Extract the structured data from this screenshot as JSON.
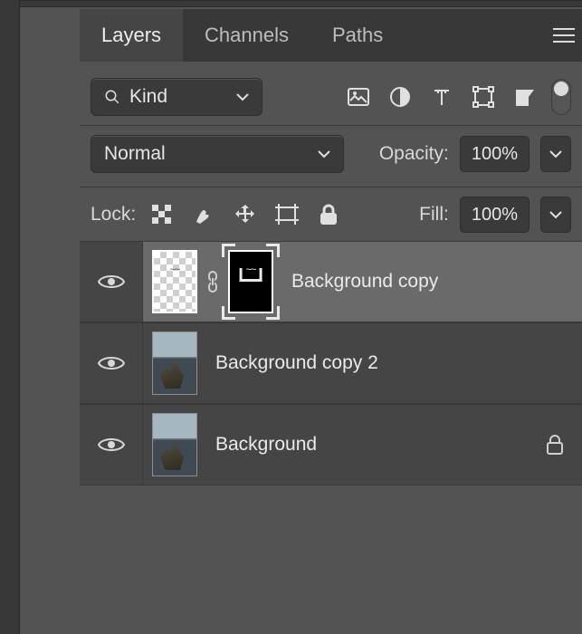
{
  "tabs": {
    "layers": "Layers",
    "channels": "Channels",
    "paths": "Paths"
  },
  "filter": {
    "kind_label": "Kind"
  },
  "blend": {
    "mode": "Normal",
    "opacity_label": "Opacity:",
    "opacity_value": "100%"
  },
  "lock": {
    "label": "Lock:",
    "fill_label": "Fill:",
    "fill_value": "100%"
  },
  "layers_list": [
    {
      "name": "Background copy",
      "selected": true,
      "has_mask": true,
      "locked": false,
      "thumb": "trans"
    },
    {
      "name": "Background copy 2",
      "selected": false,
      "has_mask": false,
      "locked": false,
      "thumb": "photo"
    },
    {
      "name": "Background",
      "selected": false,
      "has_mask": false,
      "locked": true,
      "thumb": "photo"
    }
  ]
}
